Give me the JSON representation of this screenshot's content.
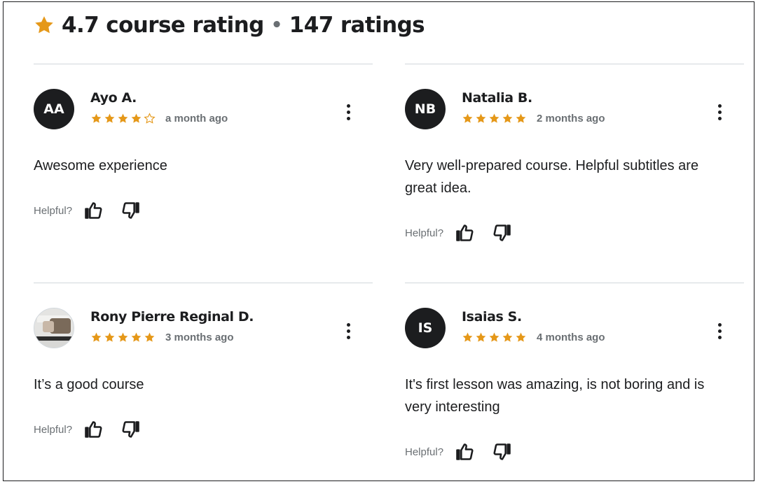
{
  "summary": {
    "rating_text": "4.7 course rating",
    "separator": "•",
    "count_text": "147 ratings"
  },
  "colors": {
    "star": "#e59819",
    "text": "#1c1d1f",
    "muted": "#6a6f73"
  },
  "helpful_label": "Helpful?",
  "reviews": [
    {
      "initials": "AA",
      "name": "Ayo A.",
      "rating": 4,
      "date": "a month ago",
      "text": "Awesome experience",
      "avatar_type": "initials"
    },
    {
      "initials": "NB",
      "name": "Natalia B.",
      "rating": 5,
      "date": "2 months ago",
      "text": "Very well-prepared course. Helpful subtitles are great idea.",
      "avatar_type": "initials"
    },
    {
      "initials": "",
      "name": "Rony Pierre Reginal D.",
      "rating": 5,
      "date": "3 months ago",
      "text": "It’s a good course",
      "avatar_type": "photo"
    },
    {
      "initials": "IS",
      "name": "Isaias S.",
      "rating": 5,
      "date": "4 months ago",
      "text": "It's first lesson was amazing, is not boring and is very interesting",
      "avatar_type": "initials"
    }
  ]
}
